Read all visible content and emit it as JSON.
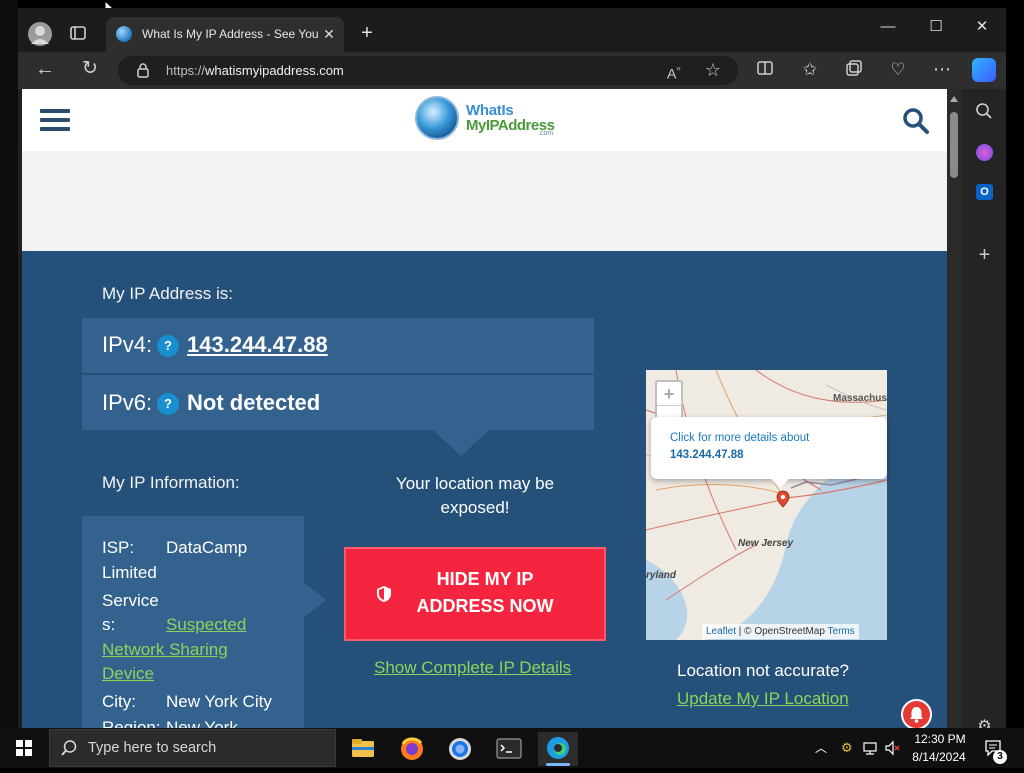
{
  "browser": {
    "tab_title": "What Is My IP Address - See Your",
    "url_prefix": "https://",
    "url_host": "whatismyipaddress.com"
  },
  "site": {
    "logo_line1": "WhatIs",
    "logo_line2": "MyIPAddress",
    "logo_line3": ".com"
  },
  "ip": {
    "heading": "My IP Address is:",
    "ipv4_label": "IPv4:",
    "ipv4_value": "143.244.47.88",
    "ipv6_label": "IPv6:",
    "ipv6_value": "Not detected",
    "help_badge": "?"
  },
  "info": {
    "heading": "My IP Information:",
    "isp_label": "ISP:",
    "isp_value_1": "DataCamp",
    "isp_value_2": "Limited",
    "service_label_1": "Service",
    "service_label_2": "s:",
    "service_value_1": "Suspected",
    "service_value_2": "Network Sharing",
    "service_value_3": "Device",
    "city_label": "City:",
    "city_value": "New York City",
    "region_label": "Region:",
    "region_value": "New York"
  },
  "cta": {
    "exposed_line1": "Your location may be",
    "exposed_line2": "exposed!",
    "hide_line1": "HIDE MY IP",
    "hide_line2": "ADDRESS NOW",
    "show_details": "Show Complete IP Details"
  },
  "map": {
    "zoom_in": "+",
    "zoom_out": "−",
    "popup_line1": "Click for more details about",
    "popup_line2": "143.244.47.88",
    "label_massachusetts": "Massachus",
    "label_new_jersey": "New Jersey",
    "label_maryland": "ryland",
    "attrib_leaflet": "Leaflet",
    "attrib_sep": " | © OpenStreetMap ",
    "attrib_terms": "Terms",
    "not_accurate": "Location not accurate?",
    "update_link": "Update My IP Location"
  },
  "taskbar": {
    "search_placeholder": "Type here to search",
    "time": "12:30 PM",
    "date": "8/14/2024",
    "notification_count": "3"
  },
  "colors": {
    "site_blue": "#25507a",
    "panel_blue": "#34628e",
    "accent_green": "#8ed35a",
    "hide_red": "#f5253f"
  }
}
